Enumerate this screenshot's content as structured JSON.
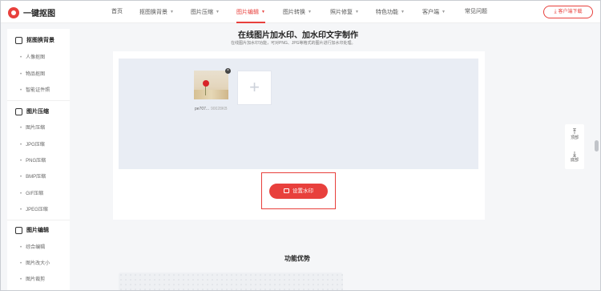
{
  "app": {
    "logo_text": "一键抠图"
  },
  "nav": {
    "items": [
      {
        "label": "首页",
        "dropdown": false
      },
      {
        "label": "抠图换背景",
        "dropdown": true
      },
      {
        "label": "图片压缩",
        "dropdown": true
      },
      {
        "label": "图片编辑",
        "dropdown": true,
        "active": true
      },
      {
        "label": "图片转换",
        "dropdown": true
      },
      {
        "label": "照片修复",
        "dropdown": true
      },
      {
        "label": "特色功能",
        "dropdown": true
      },
      {
        "label": "客户端",
        "dropdown": true
      },
      {
        "label": "常见问题",
        "dropdown": false
      }
    ],
    "download_label": "客户端下载"
  },
  "sidebar": {
    "sections": [
      {
        "title": "抠图换背景",
        "icon": "cutout-icon",
        "items": [
          "人像抠图",
          "物品抠图",
          "智能证件照"
        ]
      },
      {
        "title": "图片压缩",
        "icon": "compress-icon",
        "items": [
          "图片压缩",
          "JPG压缩",
          "PNG压缩",
          "BMP压缩",
          "GIF压缩",
          "JPEG压缩"
        ]
      },
      {
        "title": "图片编辑",
        "icon": "edit-icon",
        "items": [
          "综合编辑",
          "图片改大小",
          "图片裁剪"
        ]
      }
    ]
  },
  "main": {
    "title": "在线图片加水印、加水印文字制作",
    "description": "在线图片加水印功能，可对PNG、JPG等格式的图片进行加水印处理。",
    "file": {
      "name": "pe707...",
      "size": "90028KB"
    },
    "add_symbol": "+",
    "close_symbol": "×",
    "watermark_button": "设置水印",
    "advantages_title": "功能优势"
  },
  "float_tools": {
    "top": {
      "icon": "arrow-up-to-top-icon",
      "glyph": "⤒",
      "label": "顶部"
    },
    "bottom": {
      "icon": "arrow-down-to-bottom-icon",
      "glyph": "⤓",
      "label": "底部"
    }
  },
  "colors": {
    "accent": "#e8403c",
    "upload_bg": "#e9edf4",
    "page_bg": "#f5f6f8"
  }
}
